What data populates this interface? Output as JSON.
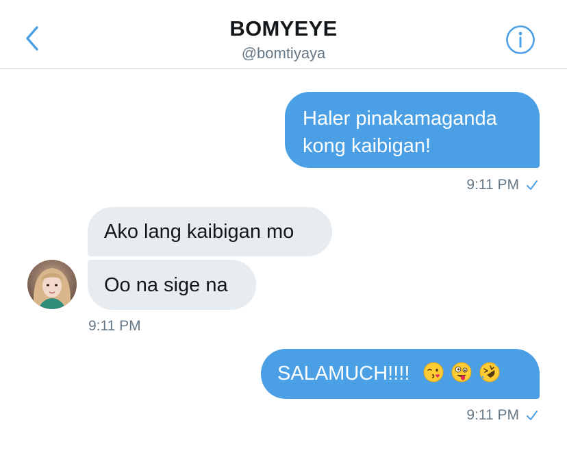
{
  "header": {
    "title": "BOMYEYE",
    "handle": "@bomtiyaya",
    "back_icon": "chevron-left-icon",
    "info_icon": "info-circle-icon"
  },
  "colors": {
    "accent": "#4a9fe5",
    "received_bubble": "#e6ecf0",
    "timestamp": "#657786",
    "title": "#14171a"
  },
  "messages": [
    {
      "direction": "sent",
      "lines": [
        "Haler pinakamaganda",
        "kong kaibigan!"
      ]
    },
    {
      "direction": "received",
      "text": "Ako lang kaibigan mo"
    },
    {
      "direction": "received",
      "text": "Oo na sige na"
    },
    {
      "direction": "sent",
      "text": "SALAMUCH!!!!",
      "emojis": [
        "kissing-wink-emoji",
        "zany-face-emoji",
        "rolling-laughing-emoji"
      ]
    }
  ],
  "timestamps": {
    "first": "9:11 PM",
    "second": "9:11 PM",
    "third": "9:11 PM"
  },
  "read_receipt_icon": "checkmark-icon"
}
